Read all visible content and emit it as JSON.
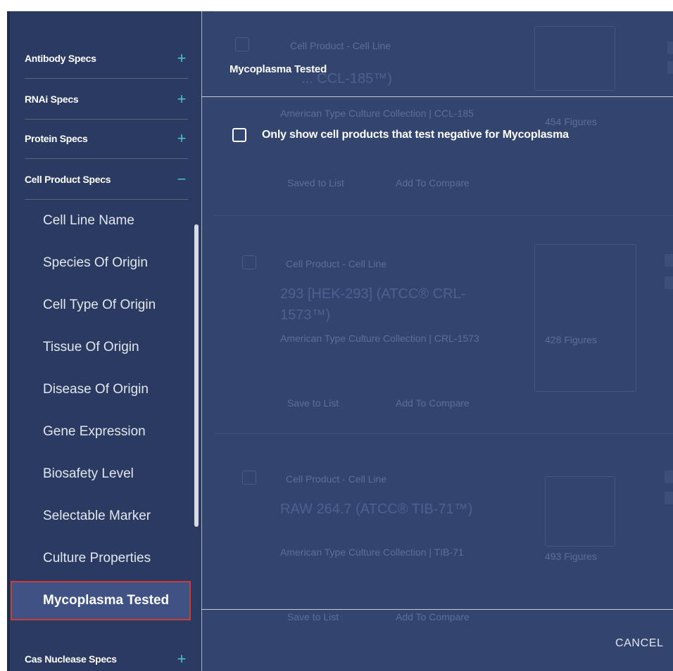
{
  "sidebar": {
    "sections": [
      {
        "label": "Antibody Specs",
        "toggle": "+"
      },
      {
        "label": "RNAi Specs",
        "toggle": "+"
      },
      {
        "label": "Protein Specs",
        "toggle": "+"
      },
      {
        "label": "Cell Product Specs",
        "toggle": "−"
      }
    ],
    "cell_product_items": [
      "Cell Line Name",
      "Species Of Origin",
      "Cell Type Of Origin",
      "Tissue Of Origin",
      "Disease Of Origin",
      "Gene Expression",
      "Biosafety Level",
      "Selectable Marker",
      "Culture Properties",
      "Mycoplasma Tested"
    ],
    "active_item": "Mycoplasma Tested",
    "bottom_section": {
      "label": "Cas Nuclease Specs",
      "toggle": "+"
    }
  },
  "background_results": [
    {
      "type": "Cell Product - Cell Line",
      "title": "... CCL-185™)",
      "source": "American Type Culture Collection | CCL-185",
      "figures": "454 Figures",
      "actions": [
        "Saved to List",
        "Add To Compare"
      ]
    },
    {
      "type": "Cell Product - Cell Line",
      "title": "293 [HEK-293] (ATCC® CRL-1573™)",
      "source": "American Type Culture Collection | CRL-1573",
      "figures": "428 Figures",
      "actions": [
        "Save to List",
        "Add To Compare"
      ]
    },
    {
      "type": "Cell Product - Cell Line",
      "title": "RAW 264.7 (ATCC® TIB-71™)",
      "source": "American Type Culture Collection | TIB-71",
      "figures": "493 Figures",
      "actions": [
        "Save to List",
        "Add To Compare"
      ]
    }
  ],
  "modal": {
    "title": "Mycoplasma Tested",
    "option_label": "Only show cell products that test negative for Mycoplasma",
    "option_checked": false,
    "cancel_label": "CANCEL"
  },
  "colors": {
    "sidebar_bg": "#2a3a61",
    "overlay_bg": "#33456e",
    "accent_teal": "#49c3c5",
    "highlight_border": "#d13a3a"
  }
}
